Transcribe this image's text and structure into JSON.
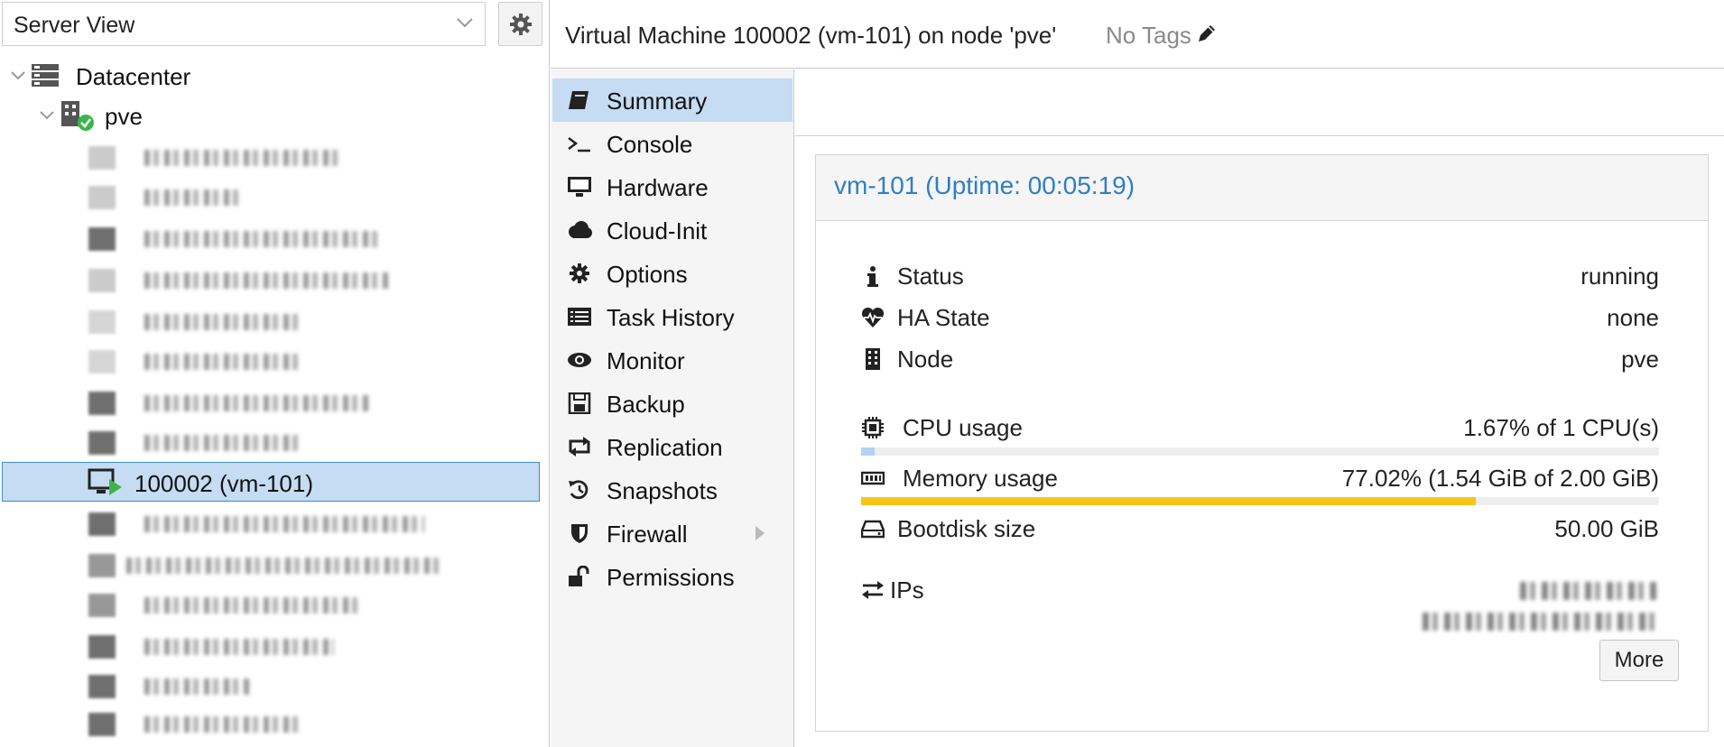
{
  "left": {
    "view_select": {
      "value": "Server View"
    },
    "tree": {
      "datacenter": "Datacenter",
      "node": "pve",
      "selected_vm": "100002 (vm-101)"
    }
  },
  "header": {
    "title": "Virtual Machine 100002 (vm-101) on node 'pve'",
    "tags": "No Tags"
  },
  "nav": {
    "items": [
      {
        "label": "Summary",
        "icon": "book-icon",
        "active": true
      },
      {
        "label": "Console",
        "icon": "terminal-icon"
      },
      {
        "label": "Hardware",
        "icon": "monitor-icon"
      },
      {
        "label": "Cloud-Init",
        "icon": "cloud-icon"
      },
      {
        "label": "Options",
        "icon": "gear-icon"
      },
      {
        "label": "Task History",
        "icon": "list-icon"
      },
      {
        "label": "Monitor",
        "icon": "eye-icon"
      },
      {
        "label": "Backup",
        "icon": "floppy-icon"
      },
      {
        "label": "Replication",
        "icon": "retweet-icon"
      },
      {
        "label": "Snapshots",
        "icon": "history-icon"
      },
      {
        "label": "Firewall",
        "icon": "shield-icon"
      },
      {
        "label": "Permissions",
        "icon": "unlock-icon"
      }
    ]
  },
  "summary": {
    "panel_title": "vm-101 (Uptime: 00:05:19)",
    "status": {
      "label": "Status",
      "value": "running"
    },
    "ha_state": {
      "label": "HA State",
      "value": "none"
    },
    "node": {
      "label": "Node",
      "value": "pve"
    },
    "cpu": {
      "label": "CPU usage",
      "value": "1.67% of 1 CPU(s)",
      "fraction": 0.0167
    },
    "memory": {
      "label": "Memory usage",
      "value": "77.02% (1.54 GiB of 2.00 GiB)",
      "fraction": 0.7702
    },
    "bootdisk": {
      "label": "Bootdisk size",
      "value": "50.00 GiB"
    },
    "ips": {
      "label": "IPs"
    },
    "more_button": "More"
  },
  "colors": {
    "accent_blue": "#2f7fc3",
    "selection_bg": "#c5dcf2",
    "memory_bar": "#f5c518",
    "cpu_bar": "#b3d2ef",
    "running_green": "#3cb54a"
  }
}
